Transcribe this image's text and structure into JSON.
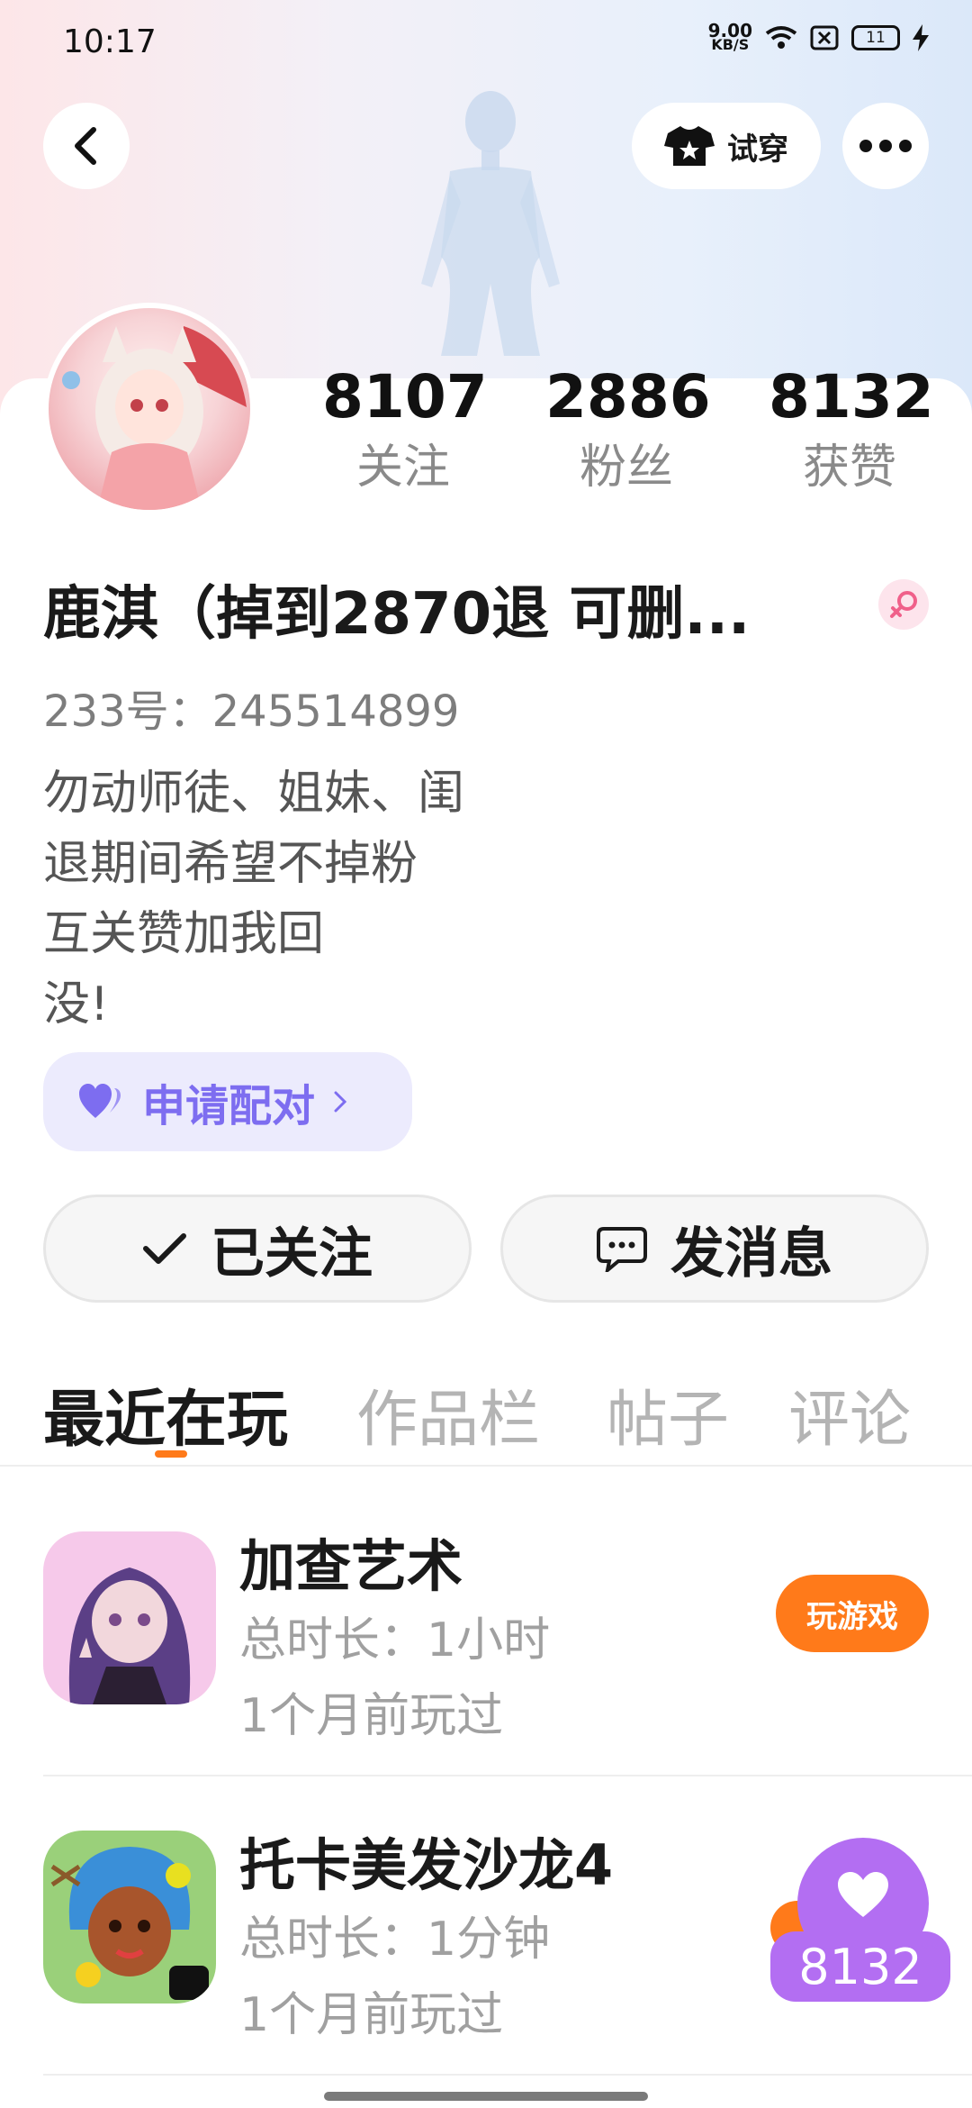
{
  "status_bar": {
    "time": "10:17",
    "net_speed_value": "9.00",
    "net_speed_unit": "KB/S",
    "battery_level": "11"
  },
  "header": {
    "try_on_label": "试穿"
  },
  "profile": {
    "stats": [
      {
        "value": "8107",
        "label": "关注"
      },
      {
        "value": "2886",
        "label": "粉丝"
      },
      {
        "value": "8132",
        "label": "获赞"
      }
    ],
    "name": "鹿淇（掉到2870退 可删...",
    "uid": "233号：245514899",
    "bio_lines": [
      "勿动师徒、姐妹、闺",
      "退期间希望不掉粉",
      "互关赞加我回",
      "没!"
    ],
    "pair_button_label": "申请配对",
    "follow_button_label": "已关注",
    "message_button_label": "发消息"
  },
  "tabs": [
    "最近在玩",
    "作品栏",
    "帖子",
    "评论"
  ],
  "games": [
    {
      "title": "加查艺术",
      "duration": "总时长：1小时",
      "last_played": "1个月前玩过",
      "action_label": "玩游戏"
    },
    {
      "title": "托卡美发沙龙4",
      "duration": "总时长：1分钟",
      "last_played": "1个月前玩过"
    }
  ],
  "floating_like": {
    "count": "8132"
  },
  "colors": {
    "accent_orange": "#ff7a1a",
    "accent_purple": "#b36ef2",
    "pair_text": "#7d6df0"
  }
}
